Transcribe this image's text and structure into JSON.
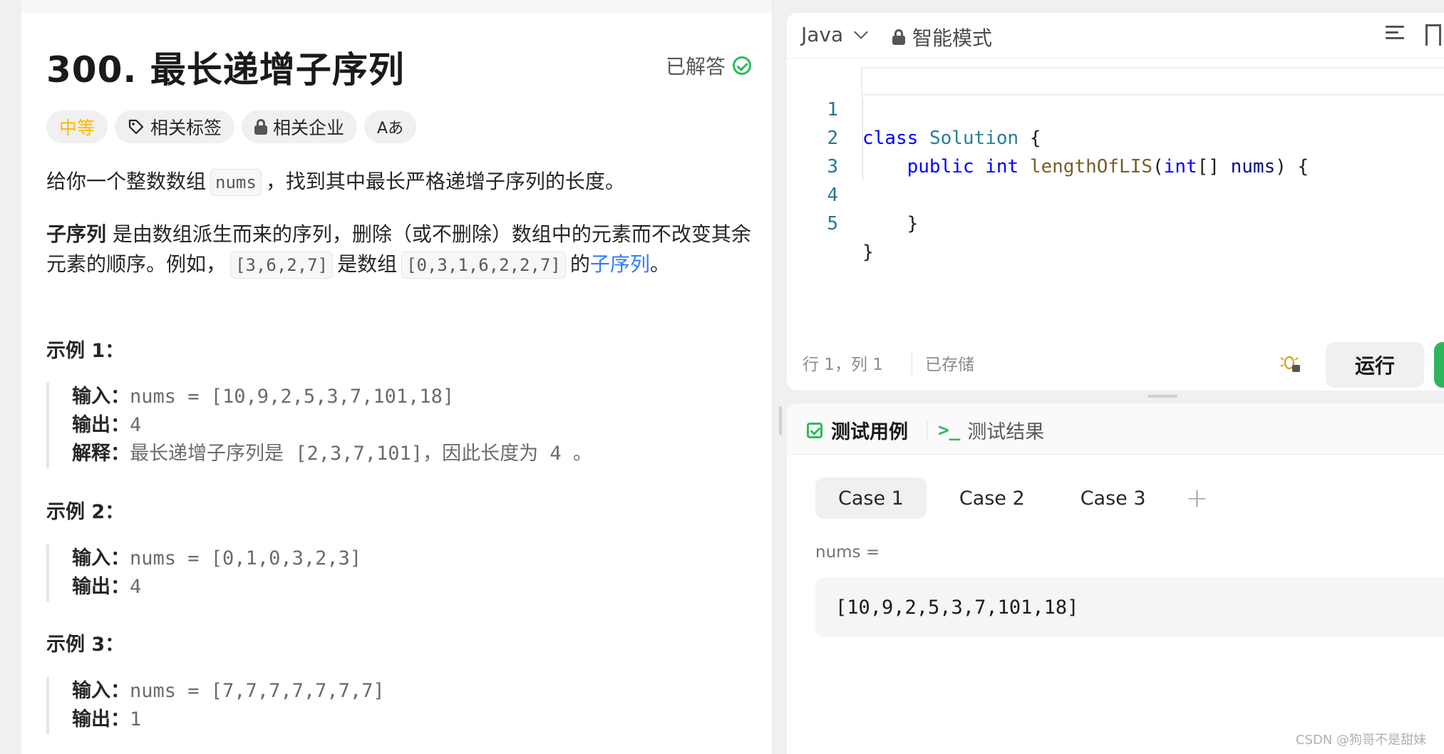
{
  "problem": {
    "title": "300. 最长递增子序列",
    "solved_label": "已解答",
    "tags": {
      "difficulty": "中等",
      "related_tags": "相关标签",
      "related_companies": "相关企业",
      "translate": "Aあ"
    },
    "description": {
      "p1_a": "给你一个整数数组",
      "p1_code": "nums",
      "p1_b": "，找到其中最长严格递增子序列的长度。",
      "p2_bold": "子序列",
      "p2_a": "是由数组派生而来的序列，删除（或不删除）数组中的元素而不改变其余元素的顺序。例如，",
      "p2_code1": "[3,6,2,7]",
      "p2_b": "是数组",
      "p2_code2": "[0,3,1,6,2,2,7]",
      "p2_c": "的",
      "p2_link": "子序列",
      "p2_d": "。"
    },
    "examples": [
      {
        "title": "示例 1：",
        "input_label": "输入：",
        "input": "nums = [10,9,2,5,3,7,101,18]",
        "output_label": "输出：",
        "output": "4",
        "explain_label": "解释：",
        "explain": "最长递增子序列是 [2,3,7,101]，因此长度为 4 。"
      },
      {
        "title": "示例 2：",
        "input_label": "输入：",
        "input": "nums = [0,1,0,3,2,3]",
        "output_label": "输出：",
        "output": "4"
      },
      {
        "title": "示例 3：",
        "input_label": "输入：",
        "input": "nums = [7,7,7,7,7,7,7]",
        "output_label": "输出：",
        "output": "1"
      }
    ]
  },
  "editor": {
    "language": "Java",
    "mode": "智能模式",
    "lines": [
      {
        "no": "1"
      },
      {
        "no": "2"
      },
      {
        "no": "3"
      },
      {
        "no": "4"
      },
      {
        "no": "5"
      }
    ],
    "code": {
      "l1_kw": "class",
      "l1_cls": "Solution",
      "l1_rest": " {",
      "l2_kw": "public",
      "l2_type": "int",
      "l2_fn": "lengthOfLIS",
      "l2_p1": "(",
      "l2_type2": "int",
      "l2_p2": "[] ",
      "l2_var": "nums",
      "l2_p3": ") {",
      "l4": "}",
      "l5": "}"
    },
    "cursor_pos": "行 1，列 1",
    "saved": "已存储",
    "run_label": "运行"
  },
  "testcase": {
    "tab_testcase": "测试用例",
    "tab_result": "测试结果",
    "cases": [
      "Case 1",
      "Case 2",
      "Case 3"
    ],
    "add_label": "+",
    "param_label": "nums =",
    "param_value": "[10,9,2,5,3,7,101,18]"
  },
  "watermark": "CSDN @狗哥不是甜妹",
  "colors": {
    "accent_green": "#2cbb5d",
    "difficulty_medium": "#ffb800",
    "link_blue": "#2f7ef2"
  }
}
